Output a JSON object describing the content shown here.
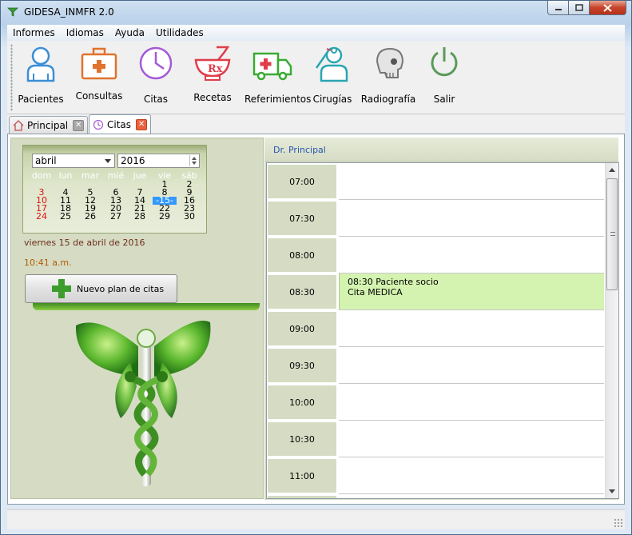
{
  "window": {
    "title": "GIDESA_INMFR 2.0"
  },
  "menu": [
    "Informes",
    "Idiomas",
    "Ayuda",
    "Utilidades"
  ],
  "toolbar": [
    {
      "label": "Pacientes",
      "icon": "patients-icon"
    },
    {
      "label": "Consultas",
      "icon": "medical-case-icon"
    },
    {
      "label": "Citas",
      "icon": "clock-icon"
    },
    {
      "label": "Recetas",
      "icon": "prescription-mortar-icon"
    },
    {
      "label": "Referimientos",
      "icon": "ambulance-icon"
    },
    {
      "label": "Cirugías",
      "icon": "surgeon-icon"
    },
    {
      "label": "Radiografía",
      "icon": "skull-xray-icon"
    },
    {
      "label": "Salir",
      "icon": "power-icon"
    }
  ],
  "tabs": [
    {
      "label": "Principal",
      "icon": "home-icon",
      "active": false
    },
    {
      "label": "Citas",
      "icon": "clock-icon",
      "active": true
    }
  ],
  "calendar": {
    "month": "abril",
    "year": "2016",
    "weekdays": [
      "dom",
      "lun",
      "mar",
      "mié",
      "jue",
      "vie",
      "sáb"
    ],
    "weeks": [
      [
        "",
        "",
        "",
        "",
        "",
        "1",
        "2"
      ],
      [
        "3",
        "4",
        "5",
        "6",
        "7",
        "8",
        "9"
      ],
      [
        "10",
        "11",
        "12",
        "13",
        "14",
        "-15-",
        "16"
      ],
      [
        "17",
        "18",
        "19",
        "20",
        "21",
        "22",
        "23"
      ],
      [
        "24",
        "25",
        "26",
        "27",
        "28",
        "29",
        "30"
      ]
    ],
    "selected_day": "-15-",
    "weekend_color": "#d11111",
    "selected_color": "#3399ff"
  },
  "left": {
    "date_text": "viernes 15 de abril de 2016",
    "time_text": "10:41 a.m.",
    "new_plan_button": "Nuevo plan de citas"
  },
  "schedule": {
    "doctor": "Dr. Principal",
    "slots": [
      {
        "time": "07:00",
        "lines": []
      },
      {
        "time": "07:30",
        "lines": []
      },
      {
        "time": "08:00",
        "lines": []
      },
      {
        "time": "08:30",
        "lines": [
          "08:30 Paciente socio",
          "Cita MEDICA"
        ]
      },
      {
        "time": "09:00",
        "lines": []
      },
      {
        "time": "09:30",
        "lines": []
      },
      {
        "time": "10:00",
        "lines": []
      },
      {
        "time": "10:30",
        "lines": []
      },
      {
        "time": "11:00",
        "lines": []
      },
      {
        "time": "",
        "lines": []
      }
    ],
    "booked_color": "#d4f3b0"
  }
}
